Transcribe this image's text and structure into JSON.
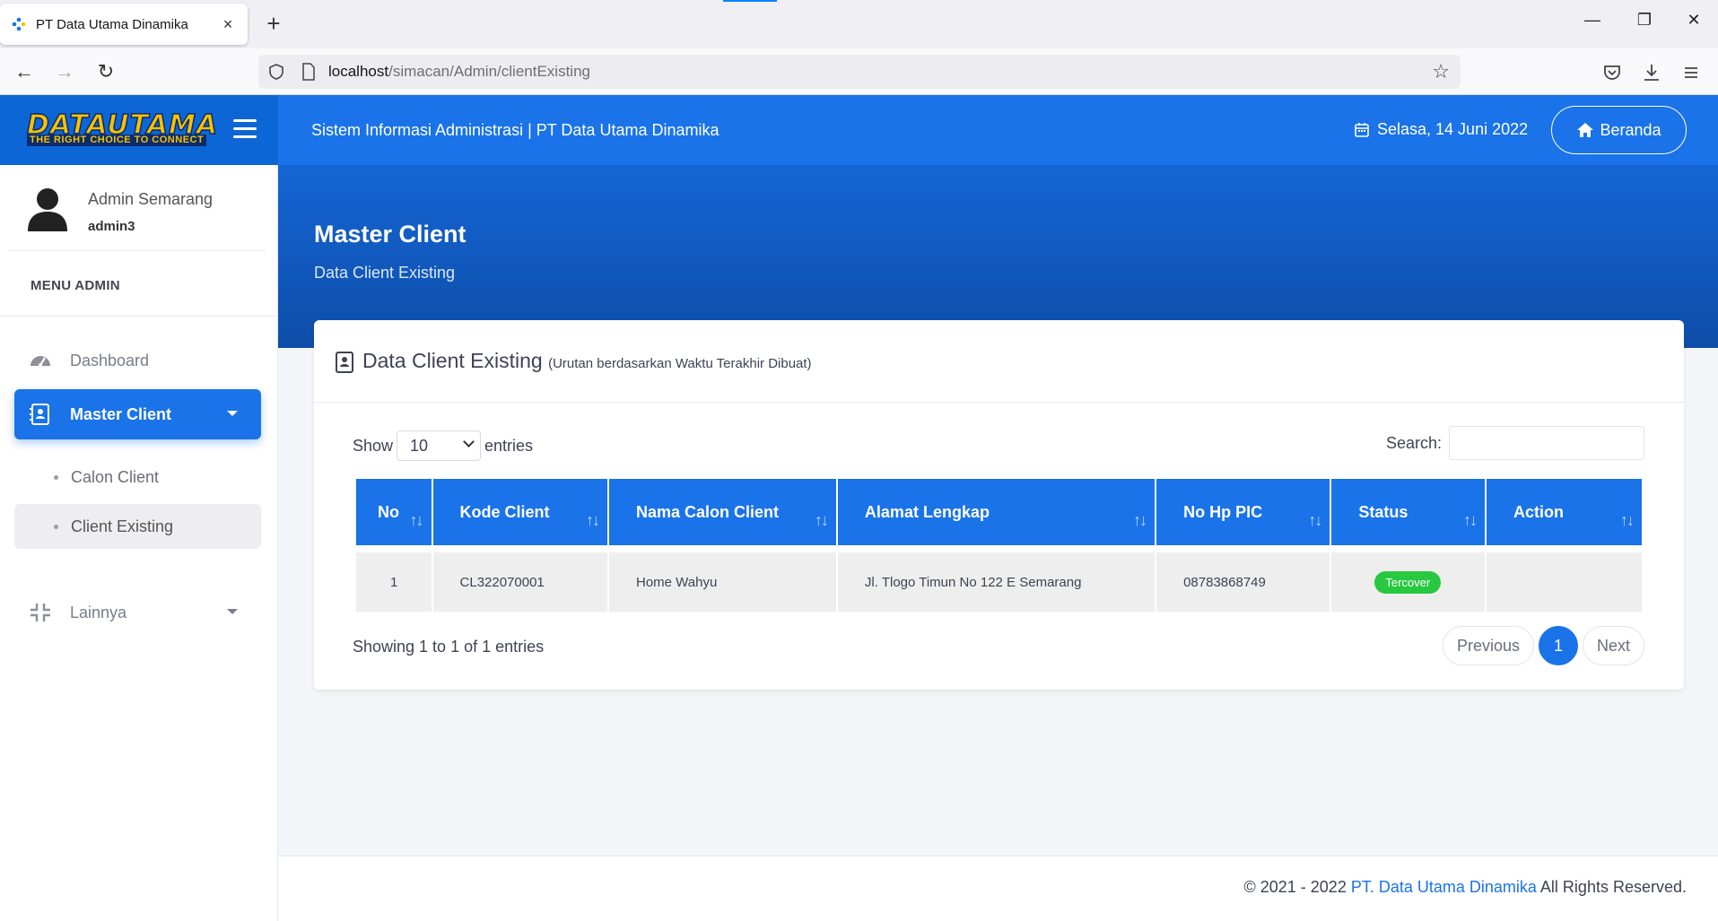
{
  "browser": {
    "tab_title": "PT Data Utama Dinamika",
    "tab_close": "×",
    "new_tab": "+",
    "url_host": "localhost",
    "url_path": "/simacan/Admin/clientExisting",
    "back": "←",
    "forward": "→",
    "reload": "↻",
    "star": "☆",
    "minimize": "—",
    "restore": "❐",
    "close": "✕"
  },
  "brand": {
    "logo_text": "DATAUTAMA",
    "logo_tagline": "THE RIGHT CHOICE TO CONNECT"
  },
  "topbar": {
    "title": "Sistem Informasi Administrasi | PT Data Utama Dinamika",
    "date": "Selasa,  14 Juni 2022",
    "beranda_label": "Beranda"
  },
  "sidebar": {
    "user_name": "Admin Semarang",
    "user_login": "admin3",
    "menu_heading": "MENU ADMIN",
    "items": [
      {
        "label": "Dashboard",
        "icon": "gauge-icon"
      },
      {
        "label": "Master Client",
        "icon": "contact-book-icon"
      },
      {
        "label": "Lainnya",
        "icon": "compress-icon"
      }
    ],
    "sub_items": [
      {
        "label": "Calon Client"
      },
      {
        "label": "Client Existing"
      }
    ]
  },
  "hero": {
    "title": "Master Client",
    "subtitle": "Data Client Existing"
  },
  "card": {
    "title": "Data Client Existing",
    "title_note": "(Urutan berdasarkan Waktu Terakhir Dibuat)",
    "show_label": "Show",
    "entries_value": "10",
    "entries_label": "entries",
    "search_label": "Search:",
    "search_value": "",
    "columns": [
      "No",
      "Kode Client",
      "Nama Calon Client",
      "Alamat Lengkap",
      "No Hp PIC",
      "Status",
      "Action"
    ],
    "sort_glyph": "↑↓",
    "rows": [
      {
        "no": "1",
        "kode": "CL322070001",
        "nama": "Home Wahyu",
        "alamat": "Jl. Tlogo Timun No 122 E Semarang",
        "hp": "08783868749",
        "status": "Tercover",
        "action": ""
      }
    ],
    "info": "Showing 1 to 1 of 1 entries",
    "pager": {
      "previous": "Previous",
      "current": "1",
      "next": "Next"
    }
  },
  "footer": {
    "prefix": "© 2021 - 2022 ",
    "company_link": "PT. Data Utama Dinamika",
    "suffix": " All Rights Reserved."
  },
  "colors": {
    "primary": "#1a73e8",
    "status_green": "#28c840",
    "logo_yellow": "#f6c200"
  }
}
